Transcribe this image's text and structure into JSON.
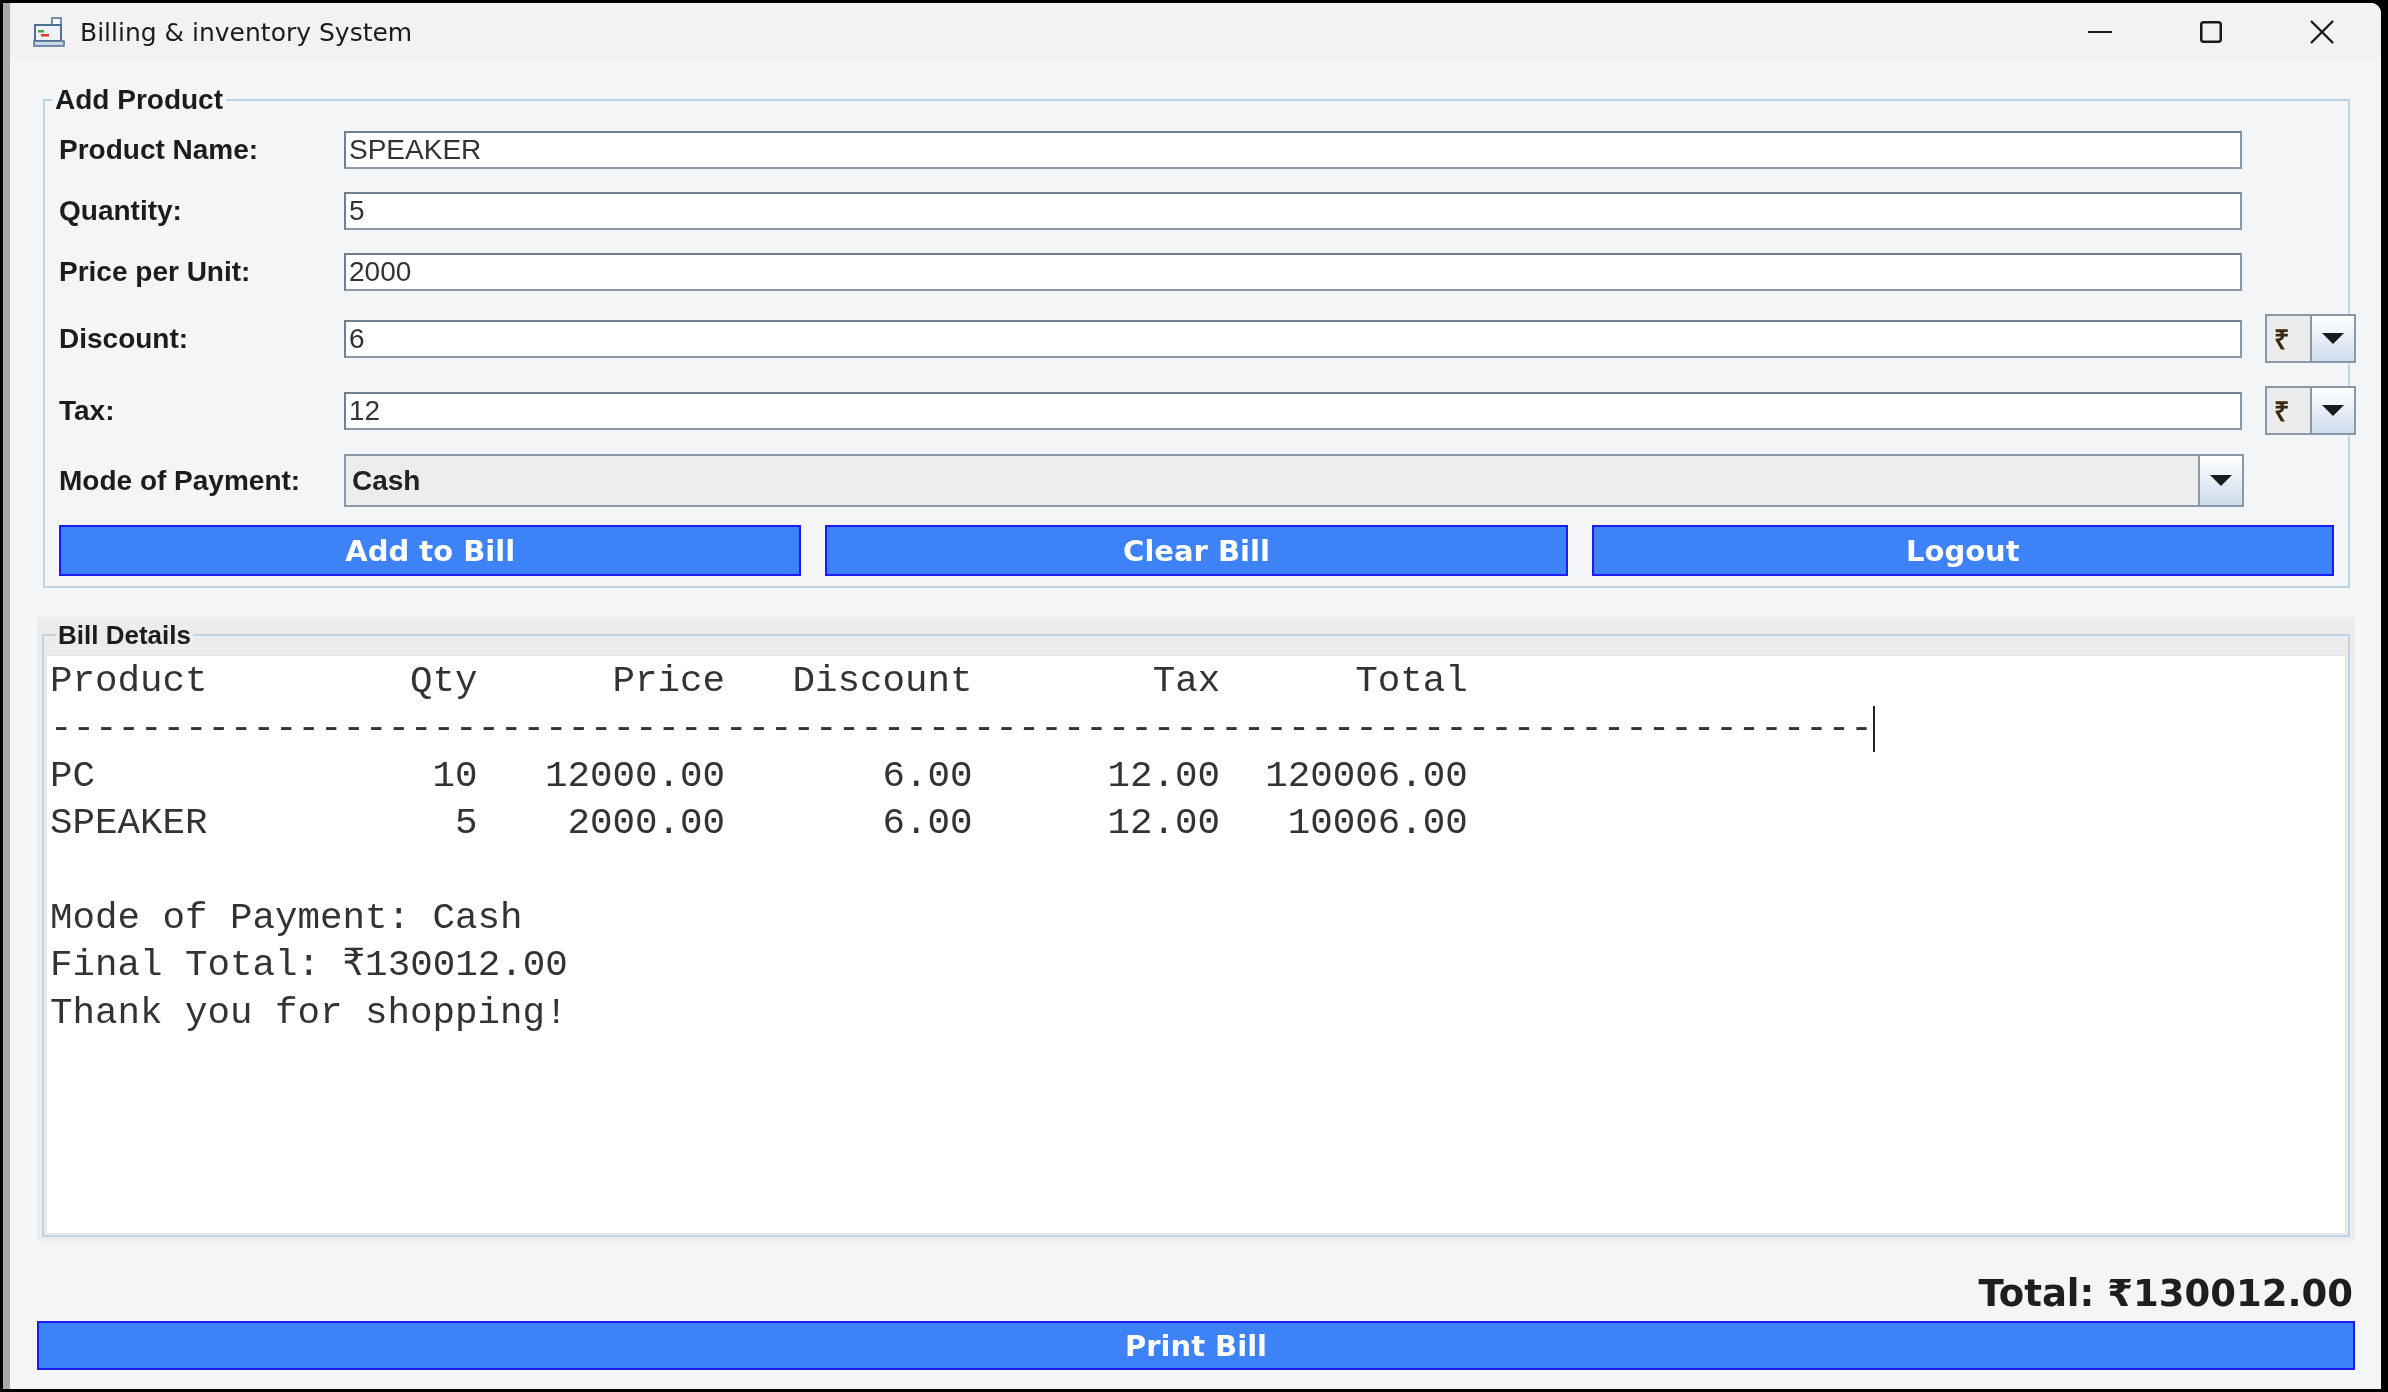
{
  "window": {
    "title": "Billing & inventory System"
  },
  "add_product": {
    "title": "Add Product",
    "fields": [
      {
        "kind": "text",
        "label": "Product Name:",
        "value": "SPEAKER"
      },
      {
        "kind": "text",
        "label": "Quantity:",
        "value": "5"
      },
      {
        "kind": "text",
        "label": "Price per Unit:",
        "value": "2000"
      },
      {
        "kind": "text",
        "label": "Discount:",
        "value": "6",
        "unit": "₹"
      },
      {
        "kind": "text",
        "label": "Tax:",
        "value": "12",
        "unit": "₹"
      },
      {
        "kind": "select",
        "label": "Mode of Payment:",
        "value": "Cash"
      }
    ],
    "buttons": [
      "Add to Bill",
      "Clear Bill",
      "Logout"
    ]
  },
  "bill_details": {
    "title": "Bill Details",
    "columns": [
      "Product",
      "Qty",
      "Price",
      "Discount",
      "Tax",
      "Total"
    ],
    "separator": "---------------------------------------------------------------------------------",
    "rows": [
      [
        "PC",
        "10",
        "12000.00",
        "6.00",
        "12.00",
        "120006.00"
      ],
      [
        "SPEAKER",
        "5",
        "2000.00",
        "6.00",
        "12.00",
        "10006.00"
      ]
    ],
    "footer_lines": [
      "Mode of Payment: Cash",
      "Final Total: ₹130012.00",
      "Thank you for shopping!"
    ]
  },
  "total": "Total: ₹130012.00",
  "print_button": "Print Bill"
}
